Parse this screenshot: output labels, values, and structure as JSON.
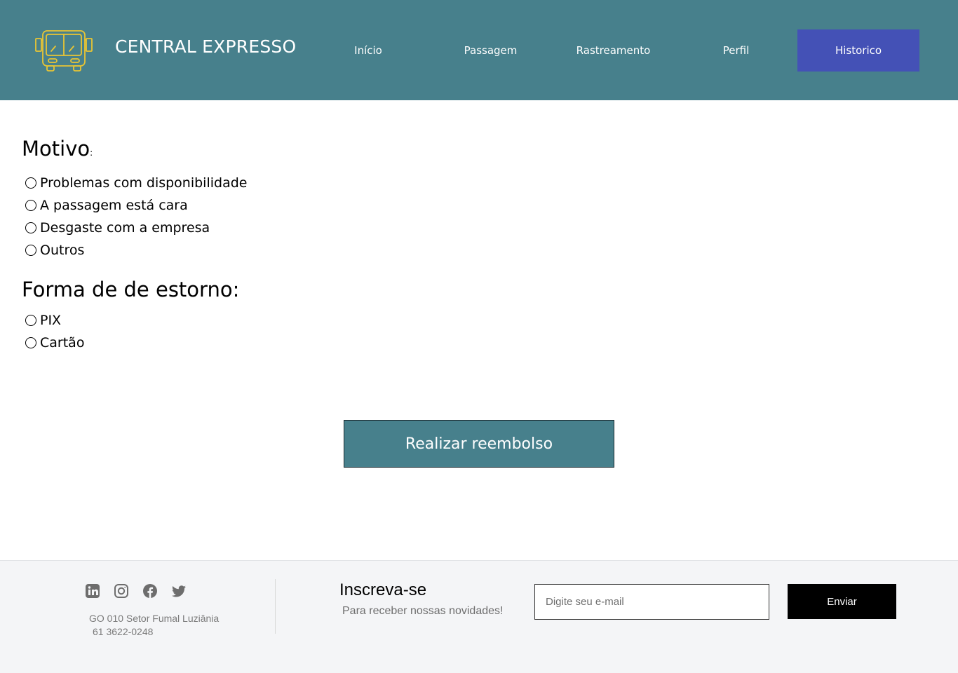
{
  "header": {
    "brand": "CENTRAL EXPRESSO",
    "logo_icon": "bus-icon",
    "nav": [
      {
        "label": "Início"
      },
      {
        "label": "Passagem"
      },
      {
        "label": "Rastreamento"
      },
      {
        "label": "Perfil"
      },
      {
        "label": "Historico",
        "active": true
      }
    ]
  },
  "form": {
    "motivo_title": "Motivo",
    "motivo_colon": ":",
    "motivo_options": [
      "Problemas com disponibilidade",
      "A passagem está cara",
      "Desgaste com a empresa",
      "Outros"
    ],
    "estorno_title": "Forma de de estorno:",
    "estorno_options": [
      "PIX",
      "Cartão"
    ],
    "submit_label": "Realizar reembolso"
  },
  "footer": {
    "social_icons": [
      "linkedin-icon",
      "instagram-icon",
      "facebook-icon",
      "twitter-icon"
    ],
    "address": "GO 010 Setor Fumal Luziânia",
    "phone": "61 3622-0248",
    "subscribe_title": "Inscreva-se",
    "subscribe_text": "Para receber nossas novidades!",
    "email_placeholder": "Digite seu e-mail",
    "send_label": "Enviar"
  },
  "colors": {
    "header_bg": "#47808c",
    "nav_active_bg": "#4451b6",
    "logo_accent": "#e8c534",
    "footer_bg": "#f4f5f7"
  }
}
